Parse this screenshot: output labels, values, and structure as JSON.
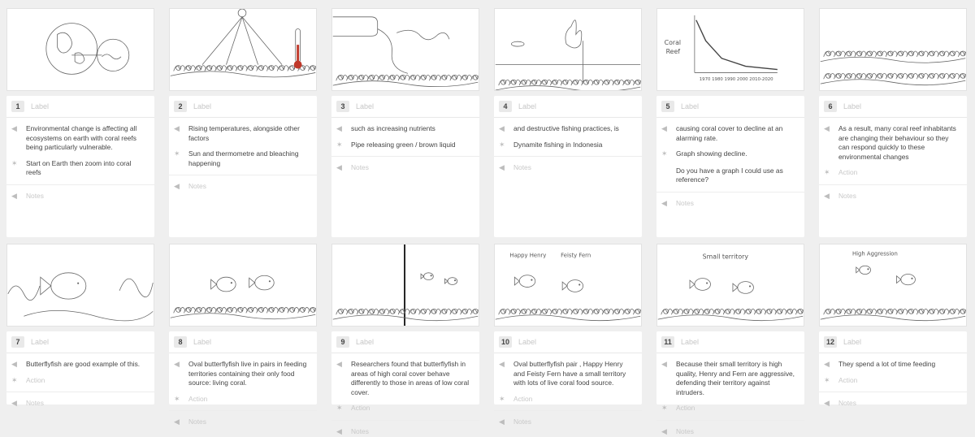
{
  "label_placeholder": "Label",
  "action_placeholder": "Action",
  "notes_placeholder": "Notes",
  "icons": {
    "dialogue": "speaker-icon",
    "action": "running-figure-icon",
    "notes": "speaker-icon"
  },
  "panels": [
    {
      "number": "1",
      "dialogue": "Environmental change is affecting all ecosystems on earth with coral reefs being particularly vulnerable.",
      "action": "Start on Earth then zoom into coral reefs",
      "action_extra": ""
    },
    {
      "number": "2",
      "dialogue": "Rising temperatures, alongside other factors",
      "action": "Sun and thermometre and bleaching happening",
      "action_extra": ""
    },
    {
      "number": "3",
      "dialogue": "such as increasing nutrients",
      "action": "Pipe releasing green / brown liquid",
      "action_extra": ""
    },
    {
      "number": "4",
      "dialogue": "and destructive fishing practices, is",
      "action": "Dynamite fishing in Indonesia",
      "action_extra": ""
    },
    {
      "number": "5",
      "dialogue": "causing coral cover to decline at an alarming rate.",
      "action": "Graph showing decline.",
      "action_extra": "Do you have a graph I could use as reference?"
    },
    {
      "number": "6",
      "dialogue": "As a result, many coral reef inhabitants are changing their behaviour so they can respond quickly to these environmental changes",
      "action": "",
      "action_extra": ""
    },
    {
      "number": "7",
      "dialogue": "Butterflyfish are good example of this.",
      "action": "",
      "action_extra": ""
    },
    {
      "number": "8",
      "dialogue": "Oval butterflyfish live in pairs in feeding territories containing their only food source: living coral.",
      "action": "",
      "action_extra": ""
    },
    {
      "number": "9",
      "dialogue": "Researchers found that butterflyfish in areas of high coral cover behave differently to those in areas of low coral cover.",
      "action": "",
      "action_extra": ""
    },
    {
      "number": "10",
      "dialogue": "Oval butterflyfish pair , Happy Henry and Feisty Fern have a small territory with lots of live coral food source.",
      "action": "",
      "action_extra": ""
    },
    {
      "number": "11",
      "dialogue": "Because their small territory is high quality, Henry and Fern are aggressive, defending their territory against intruders.",
      "action": "",
      "action_extra": ""
    },
    {
      "number": "12",
      "dialogue": "They spend a lot of time feeding",
      "action": "",
      "action_extra": ""
    }
  ],
  "sketch_text": {
    "p5_coral": "Coral",
    "p5_reef": "Reef",
    "p5_years": "1970 1980 1990 2000 2010-2020",
    "p10_a": "Happy Henry",
    "p10_b": "Feisty Fern",
    "p11": "Small territory",
    "p12": "High Aggression"
  }
}
